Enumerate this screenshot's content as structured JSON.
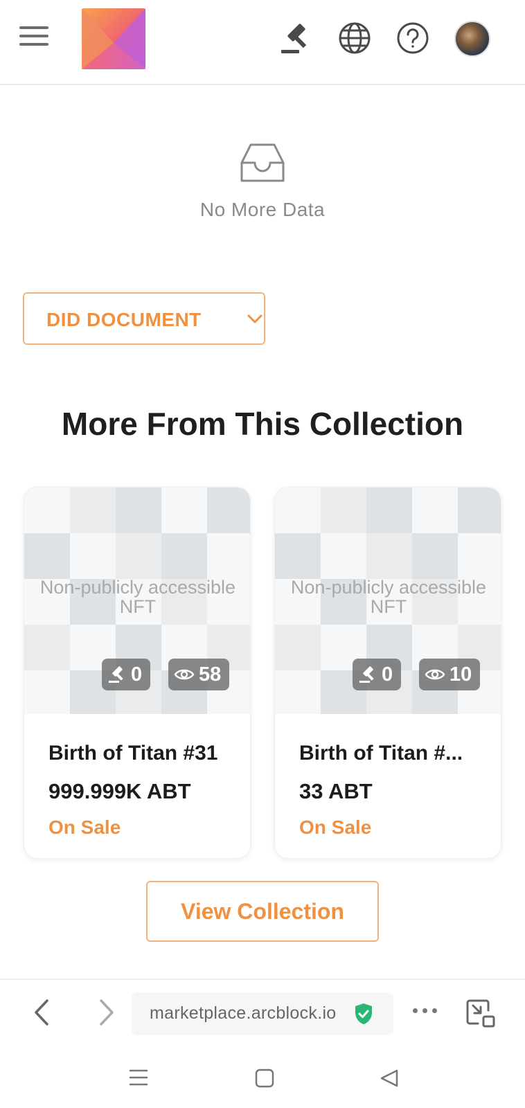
{
  "header": {
    "menu_icon": "hamburger-menu-icon",
    "logo_icon": "app-logo",
    "auction_icon": "gavel-icon",
    "language_icon": "globe-icon",
    "help_icon": "help-circle-icon",
    "avatar_icon": "user-avatar"
  },
  "empty_state": {
    "icon": "empty-inbox-icon",
    "text": "No More Data"
  },
  "did_document": {
    "label": "DID DOCUMENT",
    "icon": "chevron-down-icon"
  },
  "collection": {
    "title": "More From This Collection",
    "cards": [
      {
        "placeholder": "Non-publicly accessible NFT",
        "bids": "0",
        "views": "58",
        "name": "Birth of Titan #31",
        "price": "999.999K ABT",
        "status": "On Sale"
      },
      {
        "placeholder": "Non-publicly accessible NFT",
        "bids": "0",
        "views": "10",
        "name": "Birth of Titan #...",
        "price": "33 ABT",
        "status": "On Sale"
      }
    ],
    "view_button": "View Collection"
  },
  "browser": {
    "url": "marketplace.arcblock.io",
    "back_icon": "back-arrow-icon",
    "forward_icon": "forward-arrow-icon",
    "secure_icon": "shield-check-icon",
    "more_icon": "more-dots-icon",
    "pip_icon": "picture-in-picture-icon"
  },
  "system_nav": {
    "recents_icon": "recents-icon",
    "home_icon": "home-icon",
    "back_icon": "system-back-icon"
  },
  "colors": {
    "accent": "#ef9140",
    "accent_border": "#f3b27a",
    "secure_green": "#2bb673"
  }
}
